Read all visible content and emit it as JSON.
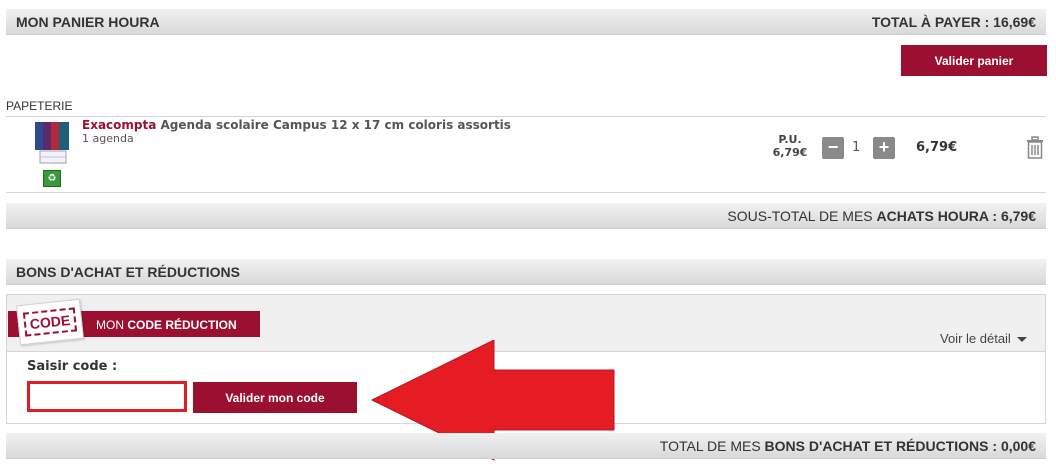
{
  "cart_header": {
    "title": "MON PANIER HOURA",
    "total_label": "TOTAL À PAYER : 16,69€"
  },
  "validate_cart_label": "Valider panier",
  "category": "PAPETERIE",
  "product": {
    "brand": "Exacompta",
    "name": "Agenda scolaire Campus 12 x 17 cm coloris assortis",
    "quantity_unit": "1 agenda",
    "pu_label": "P.U.",
    "unit_price": "6,79€",
    "quantity": "1",
    "line_total": "6,79€",
    "minus_label": "−",
    "plus_label": "+",
    "recycle_icon": "recycle-icon"
  },
  "subtotal": {
    "prefix": "SOUS-TOTAL DE MES ",
    "bold": "ACHATS HOURA",
    "suffix": " : 6,79€"
  },
  "vouchers": {
    "title": "BONS D'ACHAT ET RÉDUCTIONS",
    "stamp_label": "CODE",
    "tab_prefix": "MON ",
    "tab_bold": "CODE RÉDUCTION",
    "voir_detail": "Voir le détail",
    "saisir_label": "Saisir code :",
    "input_value": "",
    "input_placeholder": "",
    "submit_label": "Valider mon code"
  },
  "vouchers_total": {
    "prefix": "TOTAL DE MES ",
    "bold": "BONS D'ACHAT ET RÉDUCTIONS",
    "suffix": " : 0,00€"
  },
  "colors": {
    "brand": "#9b1030",
    "arrow": "#e01b24",
    "bar_gray": "#dcdcdc"
  }
}
